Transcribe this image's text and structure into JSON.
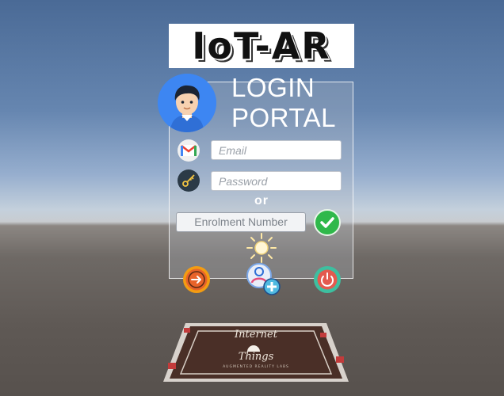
{
  "app": {
    "logo_text": "IoT-AR",
    "title_line1": "LOGIN",
    "title_line2": "PORTAL"
  },
  "login": {
    "email_placeholder": "Email",
    "password_placeholder": "Password",
    "or_label": "or",
    "enrolment_label": "Enrolment Number"
  },
  "marker": {
    "line1": "Internet",
    "line2": "Things",
    "subtitle": "AUGMENTED REALITY LABS"
  },
  "icons": {
    "avatar": "user-avatar-icon",
    "email": "gmail-icon",
    "password": "key-icon",
    "submit": "checkmark-icon",
    "brightness": "sun-icon",
    "login": "arrow-login-icon",
    "register": "add-user-icon",
    "power": "power-icon"
  },
  "colors": {
    "accent_blue": "#3d86f2",
    "check_green": "#2fb84a",
    "login_orange": "#e8632a",
    "power_teal": "#3dbfa0"
  }
}
